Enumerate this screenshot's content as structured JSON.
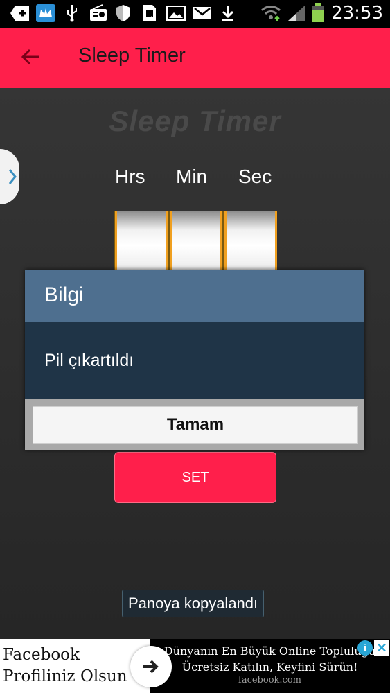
{
  "status_bar": {
    "time": "23:53",
    "icons": [
      "add-icon",
      "crown-icon",
      "usb-icon",
      "radio-icon",
      "shield-icon",
      "sim-icon",
      "image-icon",
      "gmail-icon",
      "download-icon",
      "wifi-icon",
      "signal-icon",
      "battery-icon"
    ]
  },
  "app_bar": {
    "title": "Sleep Timer",
    "back_icon": "arrow-back-icon"
  },
  "main": {
    "logo_title": "Sleep Timer",
    "columns": [
      "Hrs",
      "Min",
      "Sec"
    ],
    "set_label": "SET",
    "toast": "Panoya kopyalandı"
  },
  "dialog": {
    "title": "Bilgi",
    "message": "Pil çıkartıldı",
    "button": "Tamam"
  },
  "ad": {
    "left_line1": "Facebook",
    "left_line2": "Profiliniz Olsun",
    "line1": "Dünyanın En Büyük Online Topluluğu",
    "line2": "Ücretsiz Katılın, Keyfini Sürün!",
    "url": "facebook.com",
    "info": "i",
    "close": "✕"
  },
  "colors": {
    "accent": "#ff1f4b",
    "dialog_header": "#4e6f8f",
    "dialog_body": "#1f3447",
    "wheel_border": "#f0a020"
  }
}
